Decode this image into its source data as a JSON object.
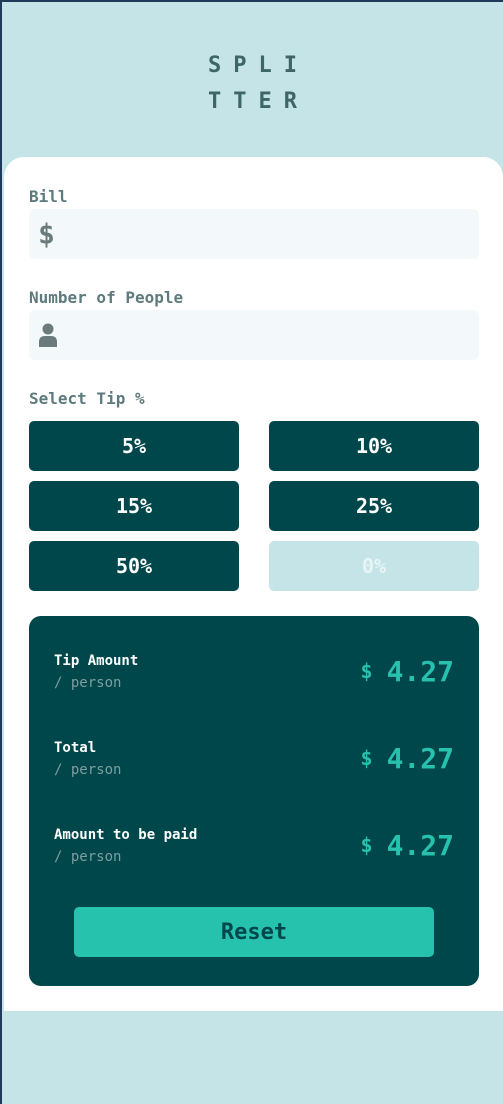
{
  "app": {
    "logo_line1": "SPLI",
    "logo_line2": "TTER"
  },
  "form": {
    "bill_label": "Bill",
    "bill_icon": "dollar-icon",
    "bill_value": "",
    "people_label": "Number of People",
    "people_icon": "person-icon",
    "people_value": "",
    "tip_label": "Select Tip %",
    "tips": [
      "5%",
      "10%",
      "15%",
      "25%",
      "50%"
    ],
    "custom_tip": "0%"
  },
  "results": {
    "currency": "$",
    "rows": [
      {
        "title": "Tip Amount",
        "sub": "/ person",
        "value": "4.27"
      },
      {
        "title": "Total",
        "sub": "/ person",
        "value": "4.27"
      },
      {
        "title": "Amount to be paid",
        "sub": "/ person",
        "value": "4.27"
      }
    ],
    "reset_label": "Reset"
  },
  "colors": {
    "background": "#c5e4e7",
    "primary": "#00474b",
    "accent": "#26c2ae",
    "input_bg": "#f3f9fa"
  }
}
